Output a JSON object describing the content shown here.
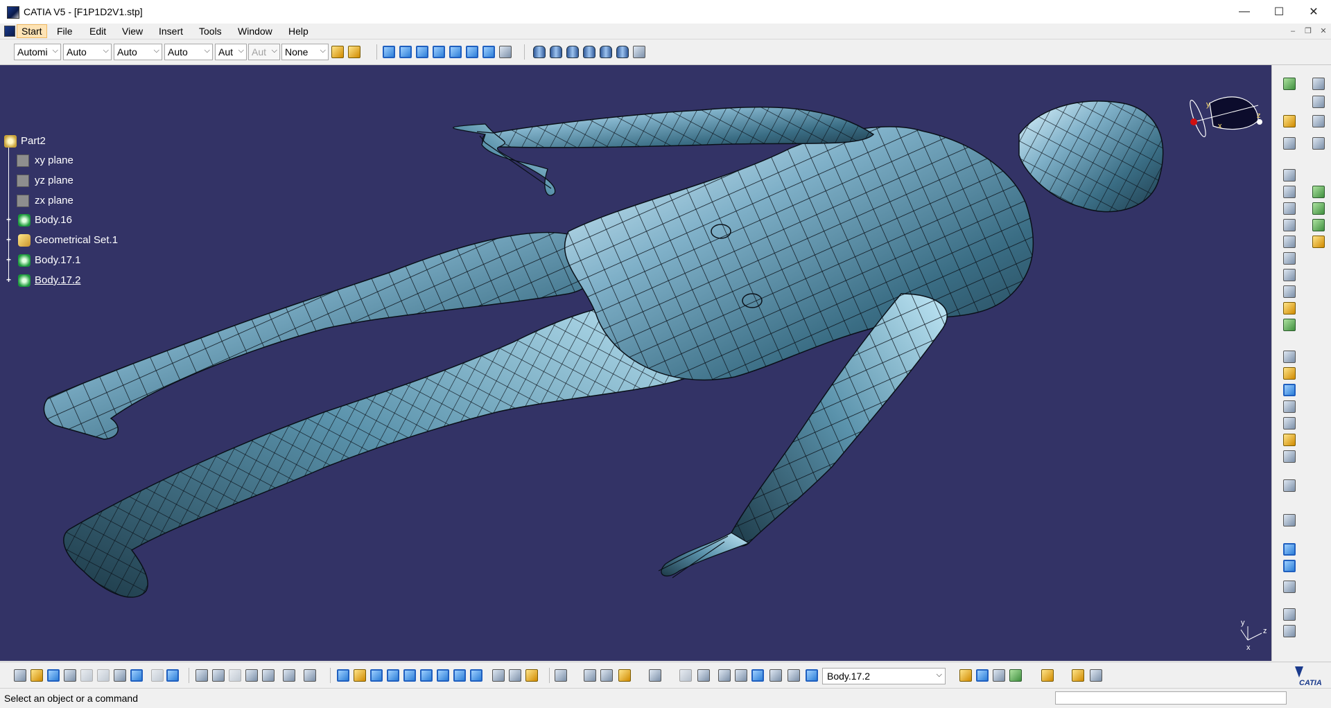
{
  "window": {
    "title": "CATIA V5 - [F1P1D2V1.stp]",
    "minimize_glyph": "—",
    "maximize_glyph": "☐",
    "close_glyph": "✕"
  },
  "menu": {
    "items": [
      "Start",
      "File",
      "Edit",
      "View",
      "Insert",
      "Tools",
      "Window",
      "Help"
    ],
    "mdi_minimize": "–",
    "mdi_restore": "❐",
    "mdi_close": "✕"
  },
  "toolbar_top": {
    "combos": [
      {
        "value": "Automi",
        "disabled": false
      },
      {
        "value": "Auto",
        "disabled": false
      },
      {
        "value": "Auto",
        "disabled": false
      },
      {
        "value": "Auto",
        "disabled": false
      },
      {
        "value": "Aut",
        "disabled": false
      },
      {
        "value": "Aut",
        "disabled": true
      },
      {
        "value": "None",
        "disabled": false
      }
    ],
    "combo_arrow": "⌵"
  },
  "tree": {
    "root": "Part2",
    "planes": [
      "xy plane",
      "yz plane",
      "zx plane"
    ],
    "bodies": [
      {
        "label": "Body.16",
        "icon": "body-icon"
      },
      {
        "label": "Geometrical Set.1",
        "icon": "geometrical-set-icon"
      },
      {
        "label": "Body.17.1",
        "icon": "body-icon"
      },
      {
        "label": "Body.17.2",
        "icon": "body-icon"
      }
    ],
    "expander_glyph": "+"
  },
  "compass": {
    "x_label": "x",
    "y_label": "y",
    "z_label": "z"
  },
  "axis_triad": {
    "x_label": "x",
    "y_label": "y",
    "z_label": "z"
  },
  "bottom_toolbar": {
    "current_body": "Body.17.2",
    "combo_arrow": "⌵",
    "logo_text": "CATIA"
  },
  "status": {
    "prompt": "Select an object or a command"
  },
  "colors": {
    "viewport_bg": "#333366",
    "model_surface": "#7fb0c8",
    "mesh_lines": "#0a1018"
  }
}
